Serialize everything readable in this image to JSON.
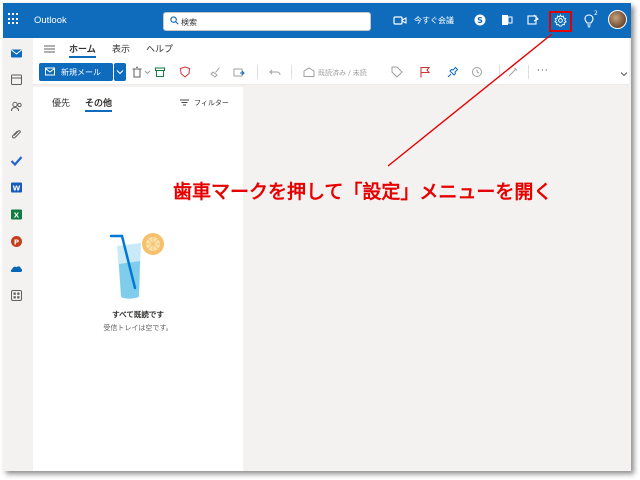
{
  "app": {
    "title": "Outlook"
  },
  "search": {
    "placeholder": "検索"
  },
  "topbar": {
    "meet_now_label": "今すぐ会議",
    "tips_count": "2",
    "icons": [
      "waffle-icon",
      "video-icon",
      "skype-icon",
      "office-icon",
      "feedback-icon",
      "gear-icon",
      "lightbulb-icon"
    ]
  },
  "ribbon": {
    "tabs": [
      {
        "label": "ホーム",
        "active": true
      },
      {
        "label": "表示",
        "active": false
      },
      {
        "label": "ヘルプ",
        "active": false
      }
    ],
    "new_mail_label": "新規メール",
    "mark_read_label": "既読済み / 未読",
    "more_label": "···"
  },
  "list": {
    "tabs": [
      {
        "label": "優先",
        "active": false
      },
      {
        "label": "その他",
        "active": true
      }
    ],
    "filter_label": "フィルター",
    "empty_title": "すべて既読です",
    "empty_subtitle": "受信トレイは空です。"
  },
  "annotation": {
    "text": "歯車マークを押して「設定」メニューを開く",
    "color": "#e60000"
  },
  "colors": {
    "brand": "#0f6cbd",
    "highlight": "#e00000"
  }
}
